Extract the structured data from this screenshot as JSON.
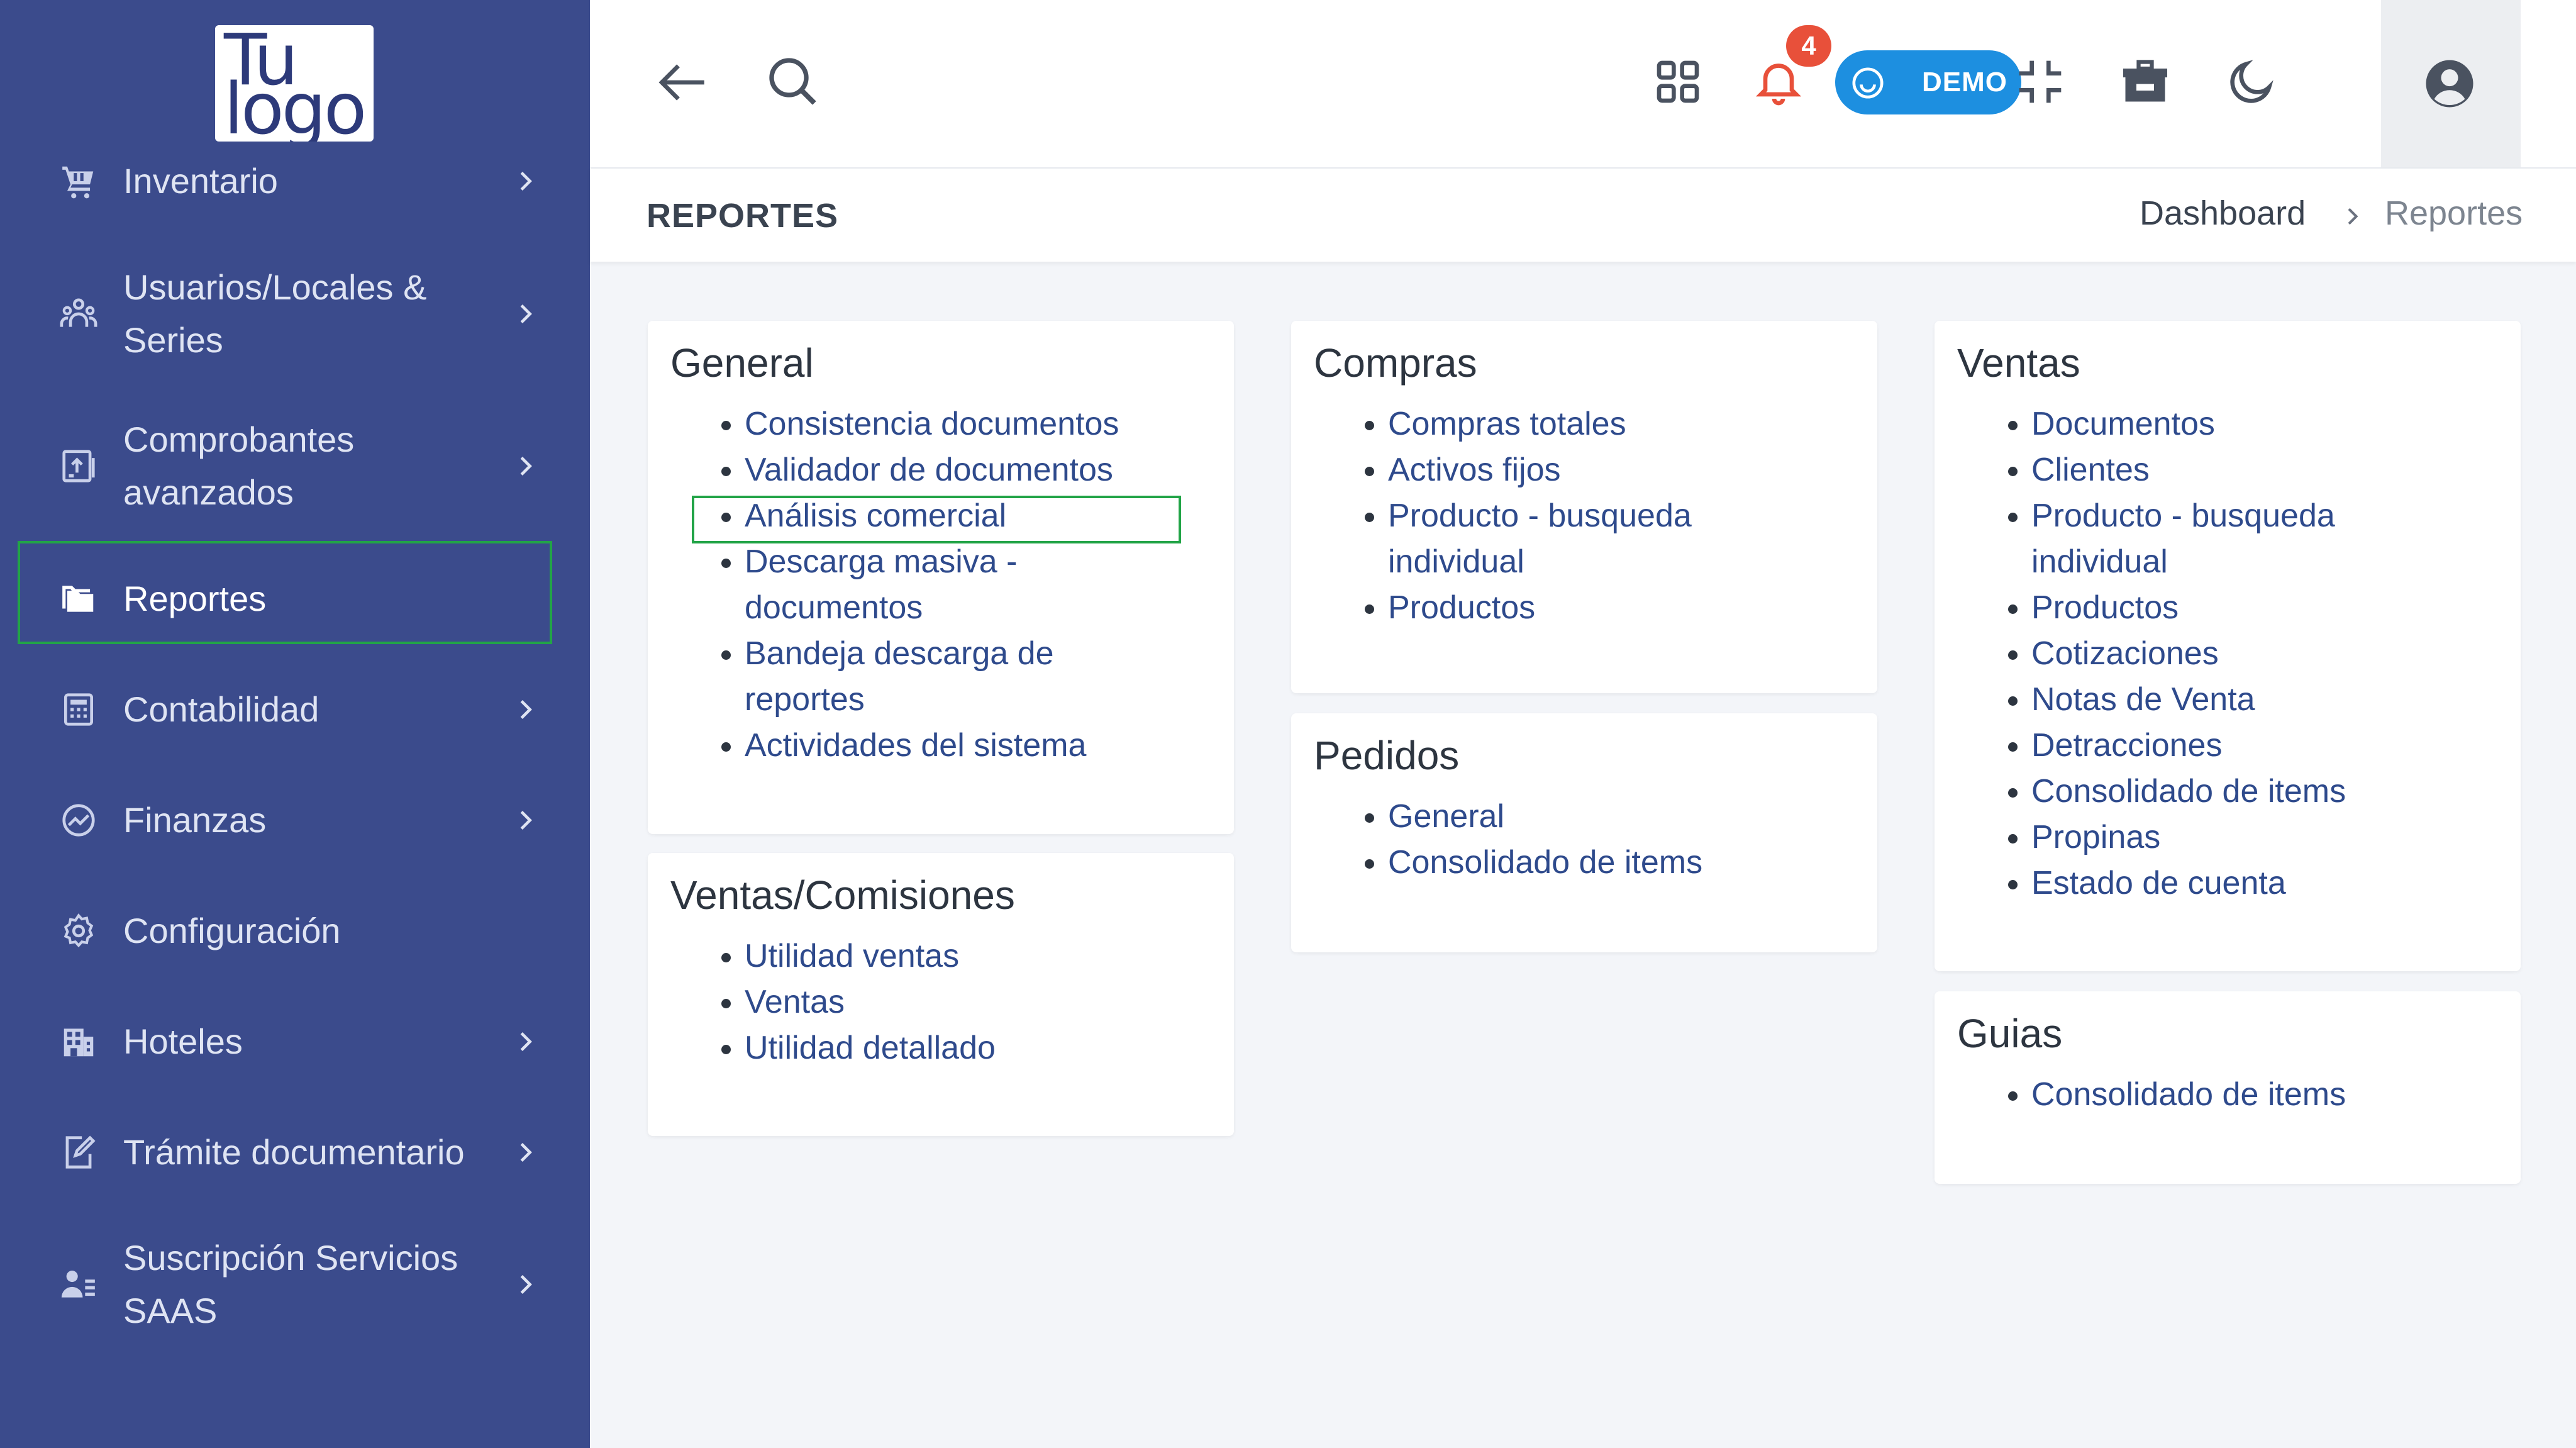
{
  "logo": {
    "line1": "Tu",
    "line2": "logo"
  },
  "sidebar": {
    "items": [
      {
        "label": "Inventario",
        "icon": "cart-icon",
        "has_chevron": true
      },
      {
        "label": "Usuarios/Locales & Series",
        "icon": "users-icon",
        "has_chevron": true
      },
      {
        "label": "Comprobantes avanzados",
        "icon": "document-upload-icon",
        "has_chevron": true
      },
      {
        "label": "Reportes",
        "icon": "folders-icon",
        "has_chevron": false,
        "active": true
      },
      {
        "label": "Contabilidad",
        "icon": "calculator-icon",
        "has_chevron": true
      },
      {
        "label": "Finanzas",
        "icon": "chart-circle-icon",
        "has_chevron": true
      },
      {
        "label": "Configuración",
        "icon": "gear-icon",
        "has_chevron": false
      },
      {
        "label": "Hoteles",
        "icon": "building-icon",
        "has_chevron": true
      },
      {
        "label": "Trámite documentario",
        "icon": "edit-document-icon",
        "has_chevron": true
      },
      {
        "label": "Suscripción Servicios SAAS",
        "icon": "user-list-icon",
        "has_chevron": true
      }
    ]
  },
  "topbar": {
    "notification_count": "4",
    "demo_label": "DEMO",
    "icons": [
      "back-arrow-icon",
      "search-icon",
      "apps-grid-icon",
      "bell-icon",
      "smile-icon",
      "compress-icon",
      "store-icon",
      "moon-icon",
      "user-circle-icon"
    ]
  },
  "page": {
    "title": "REPORTES",
    "breadcrumb": {
      "home": "Dashboard",
      "current": "Reportes"
    }
  },
  "cards": {
    "general": {
      "title": "General",
      "links": [
        "Consistencia documentos",
        "Validador de documentos",
        "Análisis comercial",
        "Descarga masiva - documentos",
        "Bandeja descarga de reportes",
        "Actividades del sistema"
      ]
    },
    "ventas_comisiones": {
      "title": "Ventas/Comisiones",
      "links": [
        "Utilidad ventas",
        "Ventas",
        "Utilidad detallado"
      ]
    },
    "compras": {
      "title": "Compras",
      "links": [
        "Compras totales",
        "Activos fijos",
        "Producto - busqueda individual",
        "Productos"
      ]
    },
    "pedidos": {
      "title": "Pedidos",
      "links": [
        "General",
        "Consolidado de items"
      ]
    },
    "ventas": {
      "title": "Ventas",
      "links": [
        "Documentos",
        "Clientes",
        "Producto - busqueda individual",
        "Productos",
        "Cotizaciones",
        "Notas de Venta",
        "Detracciones",
        "Consolidado de items",
        "Propinas",
        "Estado de cuenta"
      ]
    },
    "guias": {
      "title": "Guias",
      "links": [
        "Consolidado de items"
      ]
    }
  },
  "colors": {
    "sidebar_bg": "#3b4b8c",
    "link": "#2e4a8c",
    "badge": "#e8503a",
    "demo": "#1d8fe0",
    "highlight": "#22a447"
  }
}
